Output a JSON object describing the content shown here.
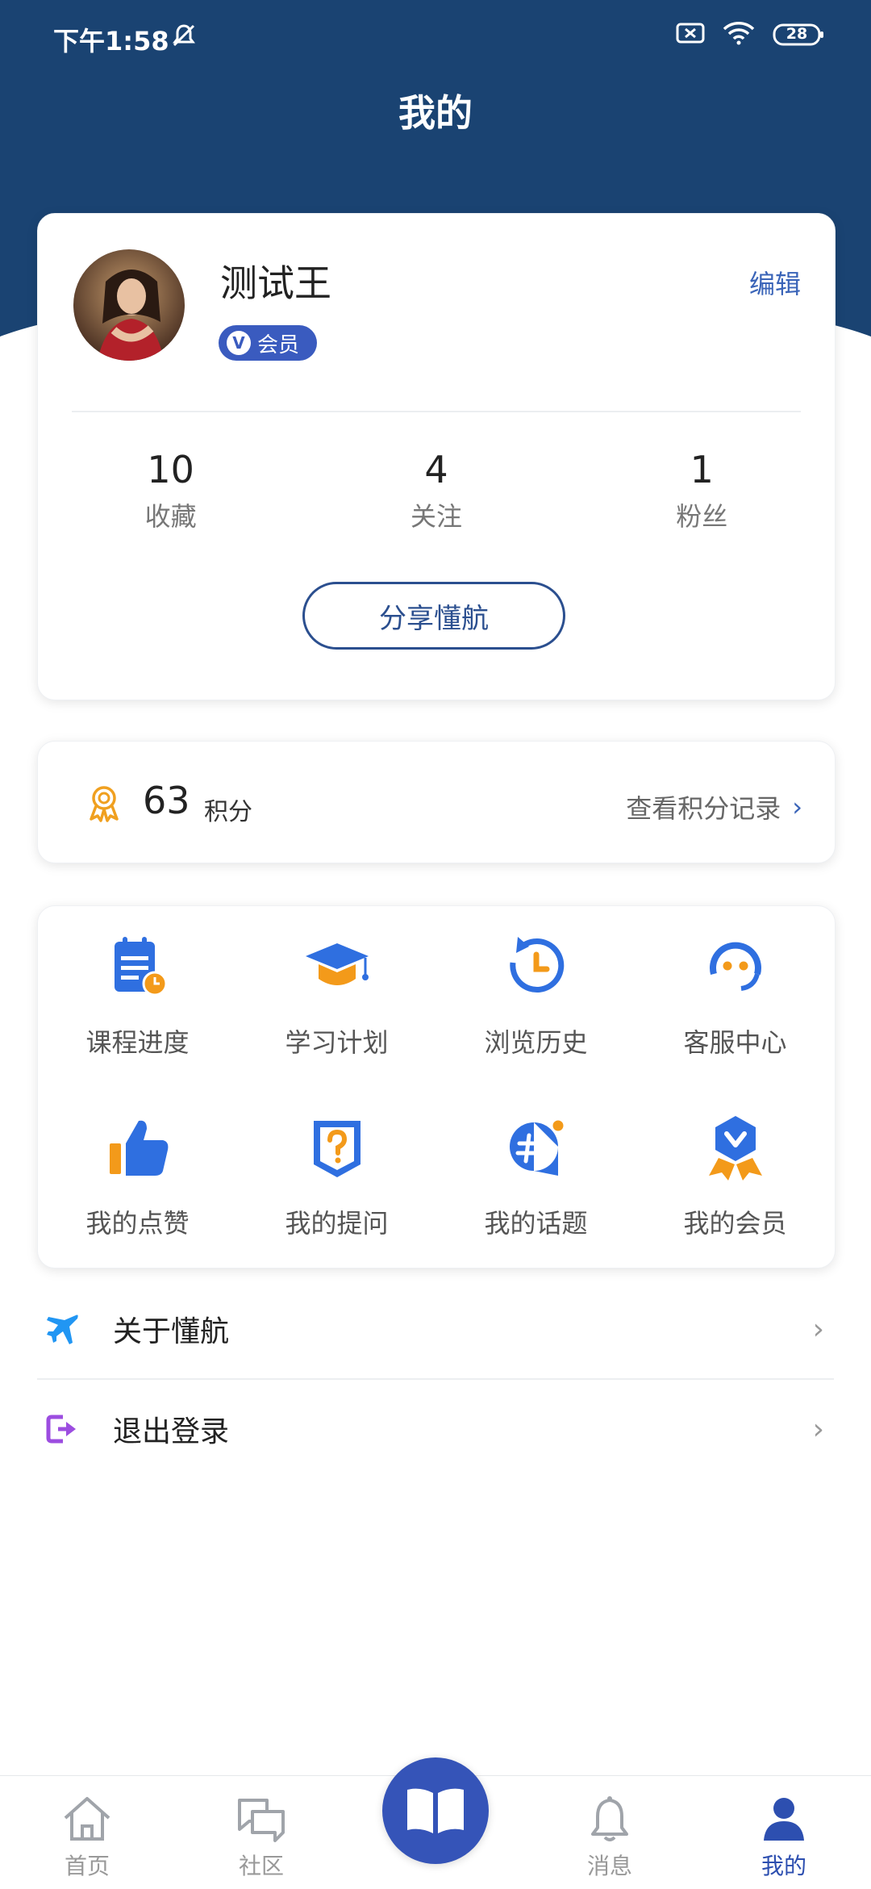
{
  "status_bar": {
    "time": "下午1:58",
    "battery": "28"
  },
  "header": {
    "title": "我的"
  },
  "profile": {
    "name": "测试王",
    "badge": "会员",
    "badge_letter": "V",
    "edit_label": "编辑",
    "stats": [
      {
        "value": "10",
        "label": "收藏"
      },
      {
        "value": "4",
        "label": "关注"
      },
      {
        "value": "1",
        "label": "粉丝"
      }
    ],
    "share_label": "分享懂航"
  },
  "points": {
    "value": "63",
    "unit": "积分",
    "link_label": "查看积分记录"
  },
  "features": [
    {
      "label": "课程进度",
      "icon": "course-progress-icon"
    },
    {
      "label": "学习计划",
      "icon": "study-plan-icon"
    },
    {
      "label": "浏览历史",
      "icon": "history-icon"
    },
    {
      "label": "客服中心",
      "icon": "customer-service-icon"
    },
    {
      "label": "我的点赞",
      "icon": "thumbs-up-icon"
    },
    {
      "label": "我的提问",
      "icon": "question-icon"
    },
    {
      "label": "我的话题",
      "icon": "topic-icon"
    },
    {
      "label": "我的会员",
      "icon": "membership-icon"
    }
  ],
  "menu": {
    "about": {
      "label": "关于懂航",
      "icon": "airplane-icon"
    },
    "logout": {
      "label": "退出登录",
      "icon": "logout-icon"
    }
  },
  "bottom_nav": {
    "items": [
      {
        "label": "首页",
        "icon": "home-icon"
      },
      {
        "label": "社区",
        "icon": "community-icon"
      },
      {
        "label": "消息",
        "icon": "bell-icon"
      },
      {
        "label": "我的",
        "icon": "person-icon"
      }
    ],
    "active": "我的"
  },
  "colors": {
    "header": "#1a4372",
    "accent": "#3554b8",
    "icon_blue": "#2f6fe0",
    "icon_orange": "#f39a1a"
  }
}
